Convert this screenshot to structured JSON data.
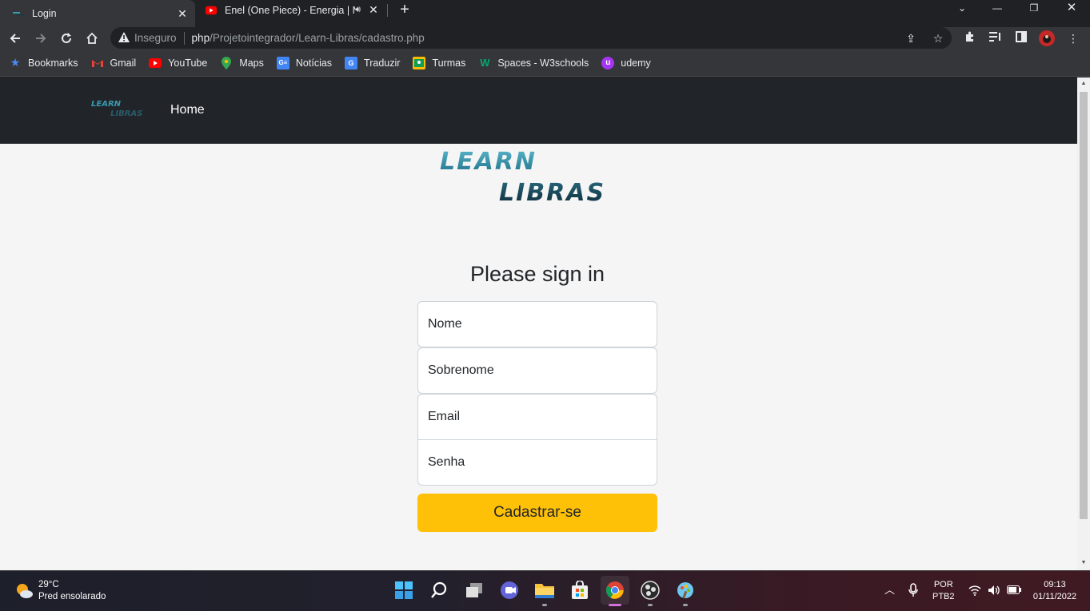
{
  "browser": {
    "tabs": [
      {
        "title": "Login",
        "active": true
      },
      {
        "title": "Enel (One Piece) - Energia | M",
        "active": false,
        "playing_audio": true
      }
    ],
    "new_tab_label": "+",
    "address": {
      "security_label": "Inseguro",
      "host": "php",
      "path": "/Projetointegrador/Learn-Libras/cadastro.php"
    },
    "bookmarks": [
      {
        "label": "Bookmarks",
        "icon": "star-icon"
      },
      {
        "label": "Gmail",
        "icon": "gmail-icon"
      },
      {
        "label": "YouTube",
        "icon": "youtube-icon"
      },
      {
        "label": "Maps",
        "icon": "maps-icon"
      },
      {
        "label": "Notícias",
        "icon": "news-icon"
      },
      {
        "label": "Traduzir",
        "icon": "translate-icon"
      },
      {
        "label": "Turmas",
        "icon": "classroom-icon"
      },
      {
        "label": "Spaces - W3schools",
        "icon": "w3schools-icon"
      },
      {
        "label": "udemy",
        "icon": "udemy-icon"
      }
    ]
  },
  "site": {
    "logo_text": [
      "LEARN",
      "LIBRAS"
    ],
    "nav": {
      "home": "Home"
    },
    "form": {
      "title": "Please sign in",
      "fields": {
        "nome": "Nome",
        "sobrenome": "Sobrenome",
        "email": "Email",
        "senha": "Senha"
      },
      "submit": "Cadastrar-se"
    }
  },
  "taskbar": {
    "weather": {
      "temp": "29°C",
      "desc": "Pred ensolarado"
    },
    "language": {
      "line1": "POR",
      "line2": "PTB2"
    },
    "clock": {
      "time": "09:13",
      "date": "01/11/2022"
    }
  },
  "colors": {
    "navbar": "#212529",
    "page_bg": "#f5f5f5",
    "button": "#ffc107",
    "logo_light": "#3a9ab0",
    "logo_dark": "#123a4a"
  }
}
